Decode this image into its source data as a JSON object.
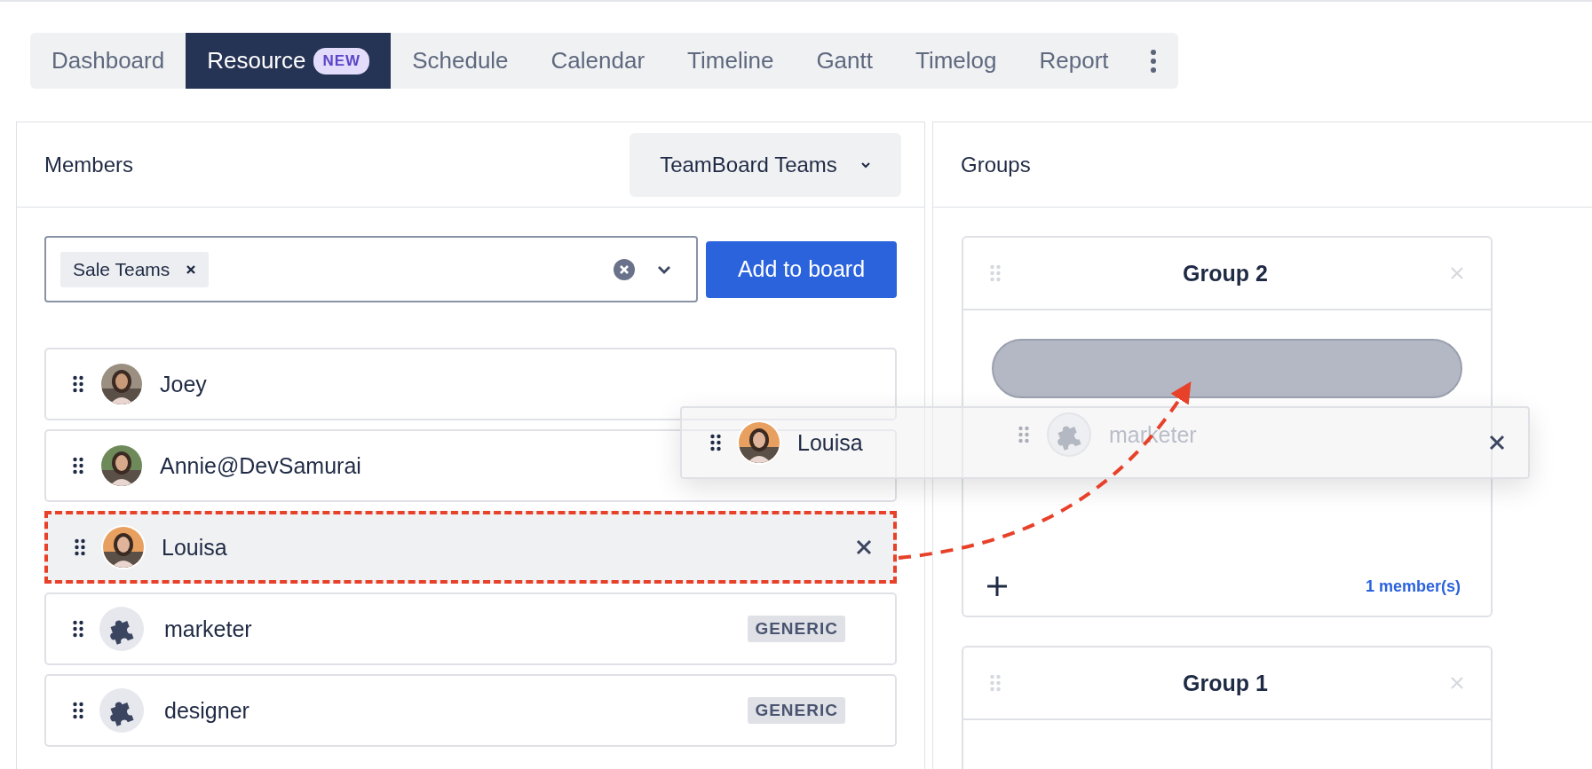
{
  "tabs": [
    {
      "label": "Dashboard",
      "selected": false
    },
    {
      "label": "Resource",
      "selected": true,
      "badge": "NEW"
    },
    {
      "label": "Schedule",
      "selected": false
    },
    {
      "label": "Calendar",
      "selected": false
    },
    {
      "label": "Timeline",
      "selected": false
    },
    {
      "label": "Gantt",
      "selected": false
    },
    {
      "label": "Timelog",
      "selected": false
    },
    {
      "label": "Report",
      "selected": false
    }
  ],
  "members_panel": {
    "title": "Members",
    "team_dropdown": "TeamBoard Teams",
    "team_select": {
      "tags": [
        "Sale Teams"
      ]
    },
    "add_button": "Add to board",
    "members": [
      {
        "name": "Joey",
        "kind": "person",
        "dragging": false
      },
      {
        "name": "Annie@DevSamurai",
        "kind": "person",
        "dragging": false
      },
      {
        "name": "Louisa",
        "kind": "person",
        "dragging": true
      },
      {
        "name": "marketer",
        "kind": "generic",
        "dragging": false,
        "badge": "GENERIC"
      },
      {
        "name": "designer",
        "kind": "generic",
        "dragging": false,
        "badge": "GENERIC"
      }
    ]
  },
  "groups_panel": {
    "title": "Groups",
    "groups": [
      {
        "title": "Group 2",
        "drop_placeholder": true,
        "members": [
          {
            "name": "marketer",
            "kind": "generic"
          }
        ],
        "count": "1 member(s)"
      },
      {
        "title": "Group 1",
        "drop_placeholder": false
      }
    ]
  },
  "drag_preview": {
    "name": "Louisa",
    "kind": "person"
  }
}
